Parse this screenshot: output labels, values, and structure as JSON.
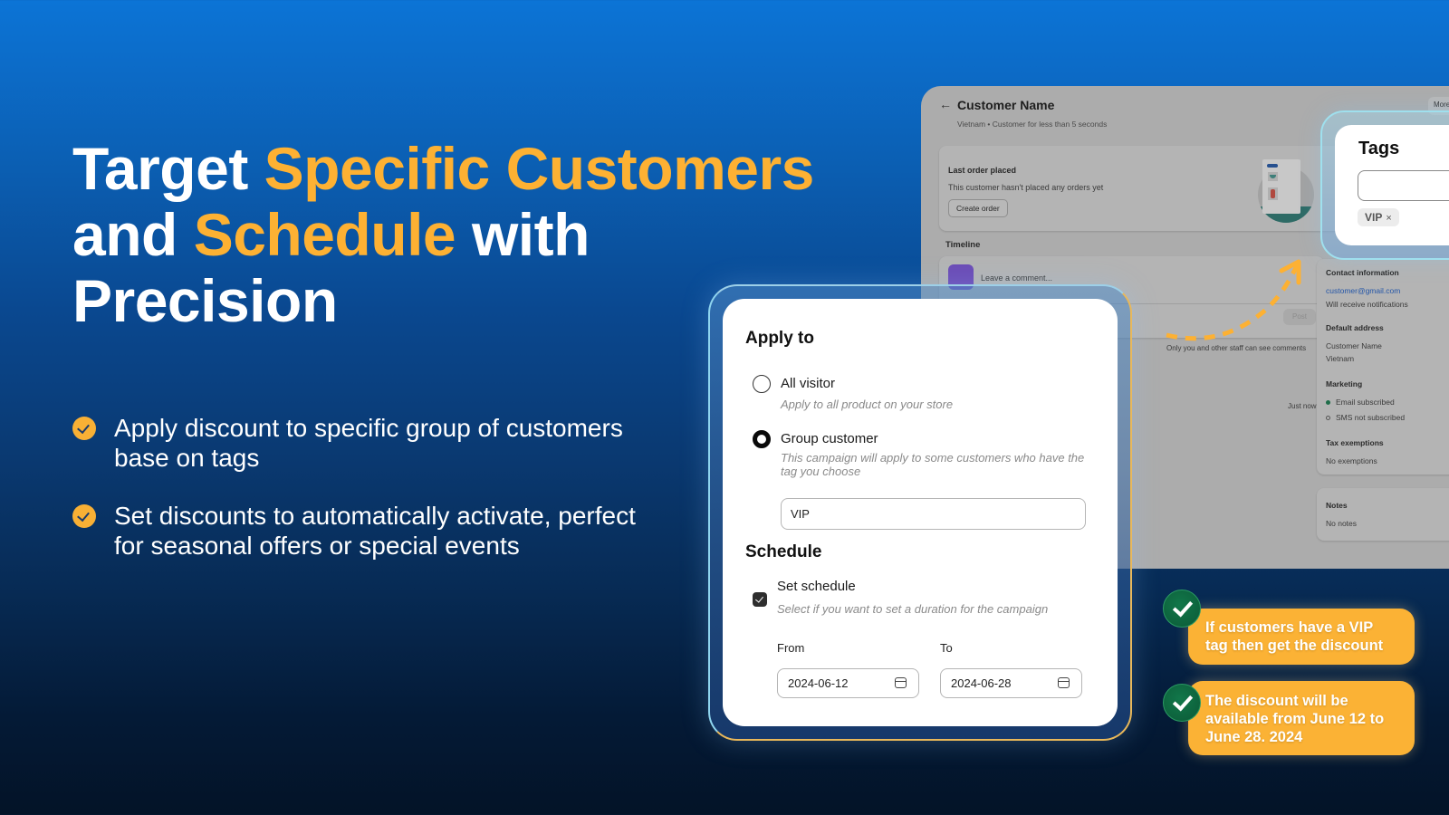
{
  "hero": {
    "title_part1": "Target ",
    "title_accent1": "Specific Customers",
    "title_part2": "and ",
    "title_accent2": "Schedule",
    "title_part3": " with",
    "title_part4": "Precision",
    "accent_color": "#fdb133"
  },
  "bullets": [
    {
      "icon": "check-circle-icon",
      "text": "Apply discount to specific group of customers base on tags"
    },
    {
      "icon": "check-circle-icon",
      "text": "Set discounts to automatically activate, perfect for seasonal offers or special events"
    }
  ],
  "customer_page": {
    "back_icon": "arrow-left-icon",
    "name": "Customer Name",
    "subtitle": "Vietnam • Customer for less than 5 seconds",
    "more_button": "More",
    "last_order": {
      "title": "Last order placed",
      "text": "This customer hasn't placed any orders yet",
      "button": "Create order"
    },
    "timeline": {
      "label": "Timeline",
      "comment_placeholder": "Leave a comment...",
      "post_button": "Post",
      "note": "Only you and other staff can see comments",
      "time": "Just now"
    },
    "sidebar": {
      "contact_label": "Contact information",
      "email": "customer@gmail.com",
      "notifications": "Will receive notifications",
      "address_label": "Default address",
      "address_name": "Customer Name",
      "address_country": "Vietnam",
      "marketing_label": "Marketing",
      "email_status": "Email subscribed",
      "sms_status": "SMS not subscribed",
      "tax_label": "Tax exemptions",
      "tax_value": "No exemptions",
      "notes_label": "Notes",
      "notes_value": "No notes"
    }
  },
  "tags_card": {
    "title": "Tags",
    "input_value": "",
    "chips": [
      {
        "label": "VIP",
        "remove_icon": "×"
      }
    ]
  },
  "apply_card": {
    "apply_title": "Apply to",
    "options": [
      {
        "label": "All visitor",
        "help": "Apply to all product on your store",
        "checked": false
      },
      {
        "label": "Group customer",
        "help": "This campaign will apply to some customers who have the tag you choose",
        "checked": true
      }
    ],
    "tag_input_value": "VIP",
    "schedule_title": "Schedule",
    "set_schedule_label": "Set schedule",
    "set_schedule_checked": true,
    "set_schedule_help": "Select if you want to set a duration for the campaign",
    "from_label": "From",
    "from_value": "2024-06-12",
    "to_label": "To",
    "to_value": "2024-06-28"
  },
  "callouts": [
    {
      "text": "If customers have a VIP tag then get the discount"
    },
    {
      "text": "The discount will be available from June 12 to June 28. 2024"
    }
  ],
  "colors": {
    "accent_orange": "#fbb235",
    "check_green": "#0b5a37",
    "bg_top": "#0c74d6",
    "bg_bottom": "#031327"
  }
}
